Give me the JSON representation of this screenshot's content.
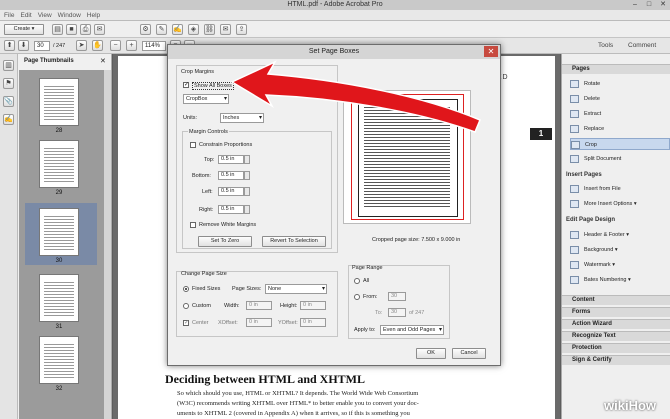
{
  "window": {
    "title": "HTML.pdf - Adobe Acrobat Pro"
  },
  "menu": [
    "File",
    "Edit",
    "View",
    "Window",
    "Help"
  ],
  "toolbar": {
    "create_label": "Create",
    "page_current": "30",
    "page_total": "/ 247",
    "zoom": "114%",
    "tools_tab": "Tools",
    "comment_tab": "Comment"
  },
  "left_panel": {
    "title": "Page Thumbnails",
    "thumbnails": [
      "28",
      "29",
      "30",
      "31",
      "32"
    ]
  },
  "document": {
    "header_fragment": "ARTED",
    "page_badge": "1",
    "heading": "Deciding between HTML and XHTML",
    "paragraph_lines": [
      "So which should you use, HTML or XHTML? It depends. The World Wide Web Consortium",
      "(W3C) recommends writing XHTML over HTML* to better enable you to convert your doc-",
      "uments to XHTML 2 (covered in Appendix A) when it arrives, so if this is something you"
    ]
  },
  "dialog": {
    "title": "Set Page Boxes",
    "crop_margins": {
      "group_title": "Crop Margins",
      "show_all_boxes": "Show All Boxes",
      "box_select": "CropBox",
      "units_label": "Units:",
      "units_value": "Inches",
      "margin_controls_title": "Margin Controls",
      "constrain_label": "Constrain Proportions",
      "top_label": "Top:",
      "top_value": "0.5 in",
      "bottom_label": "Bottom:",
      "bottom_value": "0.5 in",
      "left_label": "Left:",
      "left_value": "0.5 in",
      "right_label": "Right:",
      "right_value": "0.5 in",
      "remove_white_label": "Remove White Margins",
      "set_to_zero": "Set To Zero",
      "revert_to_selection": "Revert To Selection"
    },
    "preview_caption": "Cropped page size: 7.500 x 9.000 in",
    "change_page_size": {
      "group_title": "Change Page Size",
      "fixed_sizes": "Fixed Sizes",
      "page_sizes_label": "Page Sizes:",
      "page_sizes_value": "None",
      "custom_label": "Custom",
      "width_label": "Width:",
      "width_value": "0 in",
      "height_label": "Height:",
      "height_value": "0 in",
      "center_label": "Center",
      "xoffset_label": "XOffset:",
      "xoffset_value": "0 in",
      "yoffset_label": "YOffset:",
      "yoffset_value": "0 in"
    },
    "page_range": {
      "group_title": "Page Range",
      "all_label": "All",
      "from_label": "From:",
      "from_value": "30",
      "to_label": "To:",
      "to_value": "30",
      "of_label": "of 247",
      "apply_to_label": "Apply to:",
      "apply_to_value": "Even and Odd Pages"
    },
    "ok": "OK",
    "cancel": "Cancel"
  },
  "right_panel": {
    "pages_header": "Pages",
    "page_items": [
      "Rotate",
      "Delete",
      "Extract",
      "Replace",
      "Crop",
      "Split Document"
    ],
    "insert_pages_title": "Insert Pages",
    "insert_items": [
      "Insert from File",
      "More Insert Options"
    ],
    "edit_design_title": "Edit Page Design",
    "design_items": [
      "Header & Footer",
      "Background",
      "Watermark",
      "Bates Numbering"
    ],
    "collapsed_sections": [
      "Content",
      "Forms",
      "Action Wizard",
      "Recognize Text",
      "Protection",
      "Sign & Certify"
    ]
  },
  "watermark": "wikiHow",
  "colors": {
    "arrow": "#e0161b",
    "selected_item": "#c8d8ee",
    "dialog_close": "#c74a3f"
  }
}
